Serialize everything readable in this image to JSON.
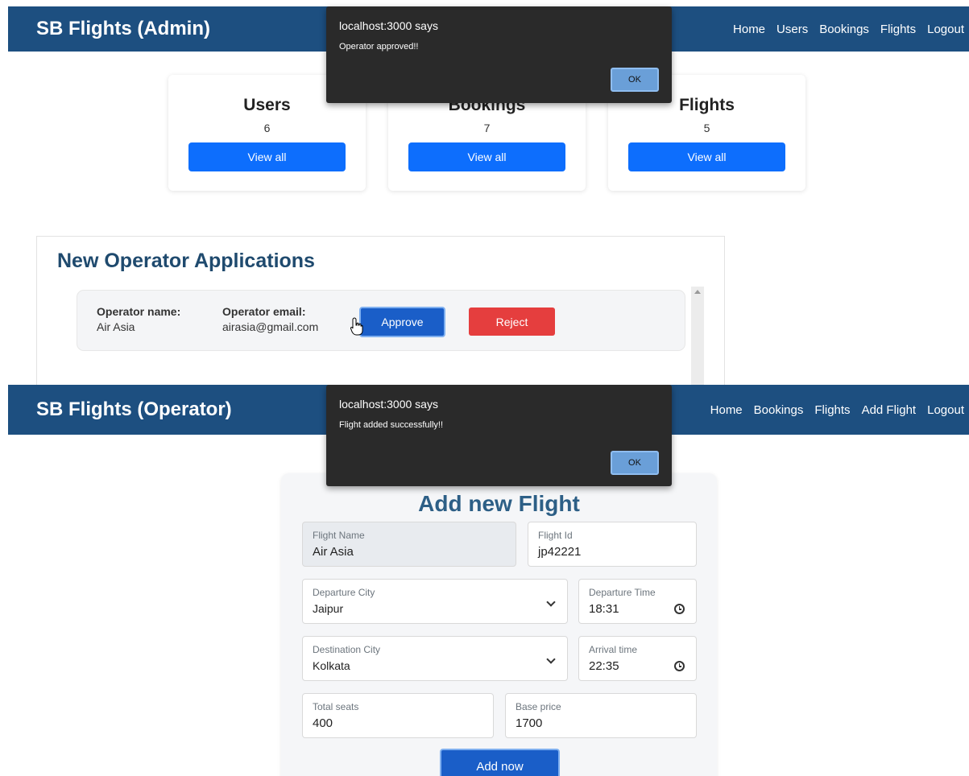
{
  "admin": {
    "brand": "SB Flights (Admin)",
    "nav": [
      "Home",
      "Users",
      "Bookings",
      "Flights",
      "Logout"
    ],
    "alert": {
      "title": "localhost:3000 says",
      "message": "Operator approved!!",
      "ok_label": "OK"
    },
    "stats": [
      {
        "title": "Users",
        "count": "6",
        "button": "View all"
      },
      {
        "title": "Bookings",
        "count": "7",
        "button": "View all"
      },
      {
        "title": "Flights",
        "count": "5",
        "button": "View all"
      }
    ],
    "applications": {
      "title": "New Operator Applications",
      "name_label": "Operator name:",
      "name_value": "Air Asia",
      "email_label": "Operator email:",
      "email_value": "airasia@gmail.com",
      "approve_label": "Approve",
      "reject_label": "Reject"
    }
  },
  "operator": {
    "brand": "SB Flights (Operator)",
    "nav": [
      "Home",
      "Bookings",
      "Flights",
      "Add Flight",
      "Logout"
    ],
    "alert": {
      "title": "localhost:3000 says",
      "message": "Flight added successfully!!",
      "ok_label": "OK"
    },
    "form": {
      "title": "Add new Flight",
      "flight_name": {
        "label": "Flight Name",
        "value": "Air Asia"
      },
      "flight_id": {
        "label": "Flight Id",
        "value": "jp42221"
      },
      "departure_city": {
        "label": "Departure City",
        "value": "Jaipur"
      },
      "departure_time": {
        "label": "Departure Time",
        "value": "18:31"
      },
      "destination_city": {
        "label": "Destination City",
        "value": "Kolkata"
      },
      "arrival_time": {
        "label": "Arrival time",
        "value": "22:35"
      },
      "total_seats": {
        "label": "Total seats",
        "value": "400"
      },
      "base_price": {
        "label": "Base price",
        "value": "1700"
      },
      "submit_label": "Add now"
    }
  }
}
